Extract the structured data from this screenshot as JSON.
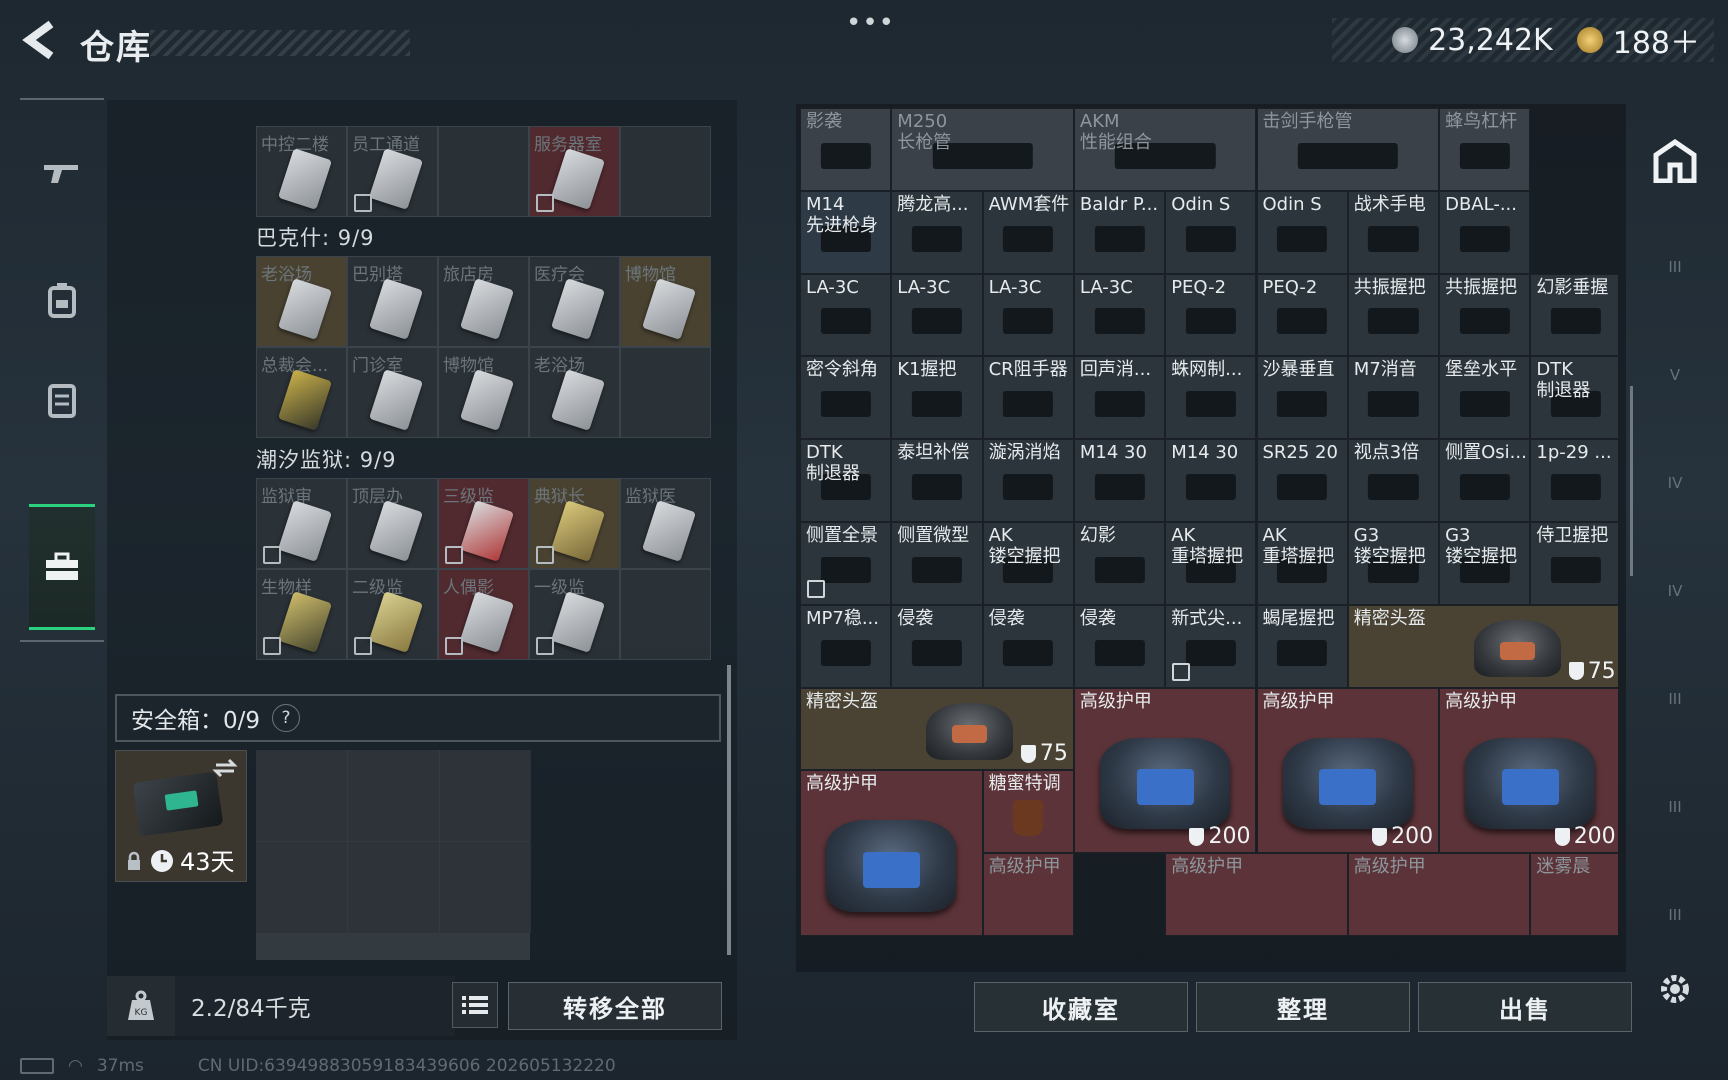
{
  "header": {
    "title": "仓库",
    "more": "•••"
  },
  "currency": [
    {
      "icon": "silver-coin-icon",
      "value": "23,242K",
      "color": "#9aa3aa"
    },
    {
      "icon": "gold-coin-icon",
      "value": "188＋",
      "color": "#c9a23a"
    }
  ],
  "left_nav": [
    {
      "icon": "gun-icon"
    },
    {
      "icon": "backpack-icon"
    },
    {
      "icon": "vest-icon"
    },
    {
      "icon": "toolbox-icon",
      "active": true
    }
  ],
  "stash": {
    "top_partial": {
      "cells": [
        "中控二楼",
        "员工通道",
        "",
        "服务器室",
        ""
      ]
    },
    "section1": {
      "title": "巴克什: 9/9",
      "row1": [
        "老浴场",
        "巴别塔",
        "旅店房",
        "医疗会",
        "博物馆"
      ],
      "row2": [
        "总裁会...",
        "门诊室",
        "博物馆",
        "老浴场",
        ""
      ]
    },
    "section2": {
      "title": "潮汐监狱: 9/9",
      "row1": [
        "监狱审",
        "顶层办",
        "三级监",
        "典狱长",
        "监狱医"
      ],
      "row2": [
        "生物样",
        "二级监",
        "人偶影",
        "一级监",
        ""
      ]
    }
  },
  "safebox": {
    "label": "安全箱：0/9",
    "help": "?",
    "days": "43天"
  },
  "weight": {
    "value": "2.2/84千克"
  },
  "transfer_all": "转移全部",
  "status": {
    "ping": "37ms",
    "uid": "CN UID:639498830591834396​06 202605132220"
  },
  "grid_items": [
    {
      "name": "影袭",
      "dim": true
    },
    {
      "name": "M250\n长枪管",
      "dim": true
    },
    {
      "name": "AKM\n性能组合",
      "dim": true
    },
    {
      "name": "击剑手枪管",
      "dim": true
    },
    {
      "name": "蜂鸟杠杆",
      "dim": true
    },
    {
      "name": "M14\n先进枪身"
    },
    {
      "name": "腾龙高..."
    },
    {
      "name": "AWM套件"
    },
    {
      "name": "Baldr P..."
    },
    {
      "name": "Odin S"
    },
    {
      "name": "Odin S"
    },
    {
      "name": "战术手电"
    },
    {
      "name": "DBAL-..."
    },
    {
      "name": "LA-3C"
    },
    {
      "name": "LA-3C"
    },
    {
      "name": "LA-3C"
    },
    {
      "name": "LA-3C"
    },
    {
      "name": "PEQ-2"
    },
    {
      "name": "PEQ-2"
    },
    {
      "name": "共振握把"
    },
    {
      "name": "共振握把"
    },
    {
      "name": "幻影垂握"
    },
    {
      "name": "密令斜角"
    },
    {
      "name": "K1握把"
    },
    {
      "name": "CR阻手器"
    },
    {
      "name": "回声消..."
    },
    {
      "name": "蛛网制..."
    },
    {
      "name": "沙暴垂直"
    },
    {
      "name": "M7消音"
    },
    {
      "name": "堡垒水平"
    },
    {
      "name": "DTK\n制退器"
    },
    {
      "name": "DTK\n制退器"
    },
    {
      "name": "泰坦补偿"
    },
    {
      "name": "漩涡消焰"
    },
    {
      "name": "M14 30"
    },
    {
      "name": "M14 30"
    },
    {
      "name": "SR25 20"
    },
    {
      "name": "视点3倍"
    },
    {
      "name": "侧置Osi..."
    },
    {
      "name": "1p-29 ..."
    },
    {
      "name": "侧置全景"
    },
    {
      "name": "侧置微型"
    },
    {
      "name": "AK\n镂空握把"
    },
    {
      "name": "幻影"
    },
    {
      "name": "AK\n重塔握把"
    },
    {
      "name": "AK\n重塔握把"
    },
    {
      "name": "G3\n镂空握把"
    },
    {
      "name": "G3\n镂空握把"
    },
    {
      "name": "侍卫握把"
    },
    {
      "name": "MP7稳..."
    },
    {
      "name": "侵袭"
    },
    {
      "name": "侵袭"
    },
    {
      "name": "侵袭"
    },
    {
      "name": "新式尖..."
    },
    {
      "name": "蝎尾握把"
    },
    {
      "name": "精密头盔",
      "durability": "75"
    },
    {
      "name": "精密头盔",
      "durability": "75"
    },
    {
      "name": "高级护甲",
      "durability": "200"
    },
    {
      "name": "高级护甲",
      "durability": "200"
    },
    {
      "name": "高级护甲",
      "durability": "200"
    },
    {
      "name": "高级护甲"
    },
    {
      "name": "糖蜜特调"
    },
    {
      "name": "高级护甲",
      "dim": true
    },
    {
      "name": "高级护甲",
      "dim": true
    },
    {
      "name": "高级护甲",
      "dim": true
    },
    {
      "name": "迷雾晨",
      "dim": true
    }
  ],
  "buttons": {
    "collection": "收藏室",
    "sort": "整理",
    "sell": "出售"
  },
  "right_nav": [
    {
      "icon": "base-icon",
      "label": ""
    },
    {
      "icon": "tier-three-armor-icon",
      "label": "III"
    },
    {
      "icon": "tier-five-armor-icon",
      "label": "V"
    },
    {
      "icon": "tier-four-armor-icon",
      "label": "IV"
    },
    {
      "icon": "tier-four-vest-icon",
      "label": "IV"
    },
    {
      "icon": "tier-three-rig-icon",
      "label": "III"
    },
    {
      "icon": "tier-three-vest-icon",
      "label": "III"
    },
    {
      "icon": "tier-three-pack-icon",
      "label": "III"
    },
    {
      "icon": "settings-icon",
      "label": ""
    }
  ]
}
